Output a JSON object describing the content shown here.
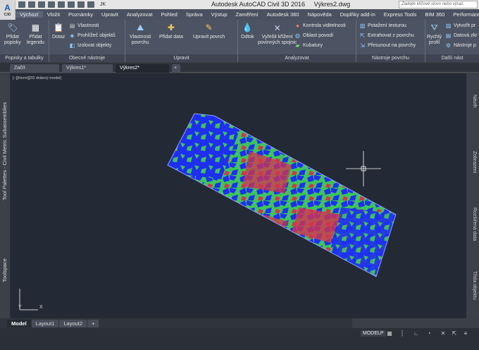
{
  "app": {
    "badge": "A",
    "badge_sub": "C3D",
    "title": "Autodesk AutoCAD Civil 3D 2016",
    "file": "Výkres2.dwg",
    "workspace": "JK",
    "search_placeholder": "Zadejte klíčové slovo nebo výraz."
  },
  "menu": [
    "Výchozí",
    "Vložit",
    "Poznámky",
    "Upravit",
    "Analyzovat",
    "Pohled",
    "Správa",
    "Výstup",
    "Zaměření",
    "Autodesk 360",
    "Nápověda",
    "Doplňky add-in",
    "Express Tools",
    "BIM 360",
    "Performance"
  ],
  "ribbon": {
    "p1": {
      "title": "Popisky a tabulky",
      "b1": "Přidat",
      "b1b": "popisky",
      "b2": "Přidat",
      "b2b": "legendu"
    },
    "p2": {
      "title": "Obecné nástroje",
      "big": "Dotaz",
      "s1": "Vlastnosti",
      "s2": "Prohlížeč objektů",
      "s3": "Izolovat objekty"
    },
    "p3": {
      "title": "Upravit",
      "b1": "Vlastnosti",
      "b1b": "povrchu",
      "b2": "Přidat data",
      "b3": "Upravit povrch"
    },
    "p4": {
      "title": "Analyzovat",
      "b1": "Odtok",
      "b2": "Vyřešit křížení",
      "b2b": "povinných spojnic",
      "s1": "Kontrola viditelnosti",
      "s2": "Oblast povodí",
      "s3": "Kubatury"
    },
    "p5": {
      "title": "Nástroje povrchu",
      "s1": "Potažení texturou",
      "s2": "Extrahovat z povrchu",
      "s3": "Přesunout na povrchy"
    },
    "p6": {
      "title": "Další nást",
      "b1": "Rychlý",
      "b1b": "profil",
      "s1": "Vytvořit pr",
      "s2": "Datová zkr",
      "s3": "Nástroje p"
    }
  },
  "file_tabs": [
    "Začít",
    "Výkres1*",
    "Výkres2*"
  ],
  "viewport_label": "[−][Horní][2D drátový model]",
  "ucs": {
    "x": "X",
    "y": "Y"
  },
  "left_palettes": [
    "Tool Palettes - Civil Metric Subassemblies",
    "Toolspace"
  ],
  "right_palettes": [
    "Návrh",
    "Zobrazení",
    "Rozšířená data",
    "Třída objektu"
  ],
  "layout_tabs": [
    "Model",
    "Layout1",
    "Layout2",
    "+"
  ],
  "status": {
    "model": "MODELP"
  },
  "colors": {
    "blue": "#1f2ff0",
    "green": "#3ec45a",
    "red": "#d6334f",
    "ribbon": "#4c5362",
    "canvas": "#232a35"
  }
}
